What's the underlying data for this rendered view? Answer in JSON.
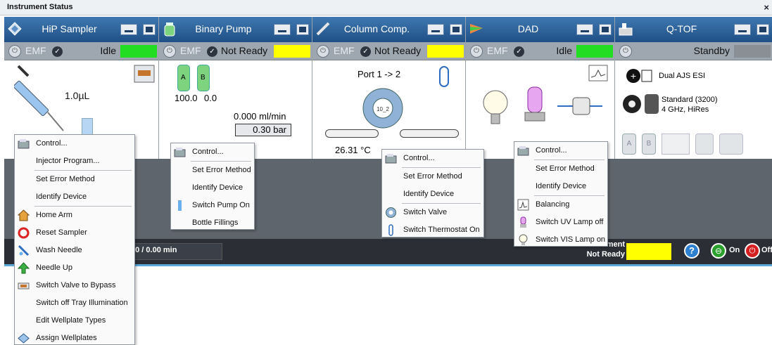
{
  "window": {
    "title": "Instrument Status",
    "close": "×"
  },
  "modules": [
    {
      "name": "HiP Sampler",
      "status": "Idle",
      "status_color": "#22dd22"
    },
    {
      "name": "Binary Pump",
      "status": "Not Ready",
      "status_color": "#ffff00"
    },
    {
      "name": "Column Comp.",
      "status": "Not Ready",
      "status_color": "#ffff00"
    },
    {
      "name": "DAD",
      "status": "Idle",
      "status_color": "#22dd22"
    },
    {
      "name": "Q-TOF",
      "status": "Standby",
      "status_color": "#8a8f96"
    }
  ],
  "emf_label": "EMF",
  "sampler": {
    "volume": "1.0µL"
  },
  "pump": {
    "bottle_a": "A",
    "bottle_b": "B",
    "val_a": "100.0",
    "val_b": "0.0",
    "flow": "0.000 ml/min",
    "pressure": "0.30 bar"
  },
  "column": {
    "port": "Port 1 -> 2",
    "temp_left": "26.31 °C",
    "valve_label": "10_2"
  },
  "qtof": {
    "source": "Dual AJS ESI",
    "mode_line1": "Standard (3200)",
    "mode_line2": "4 GHz, HiRes",
    "vial_a": "A",
    "vial_b": "B"
  },
  "bottom": {
    "runtime": "00 / 0.00 min",
    "instrument_label": "Instrument",
    "instrument_status": "Not Ready",
    "status_color": "#ffff00",
    "help": "?",
    "on_label": "On",
    "off_label": "Off"
  },
  "menus": {
    "sampler": [
      "Control...",
      "Injector Program...",
      "Set Error Method",
      "Identify Device",
      "Home Arm",
      "Reset Sampler",
      "Wash Needle",
      "Needle Up",
      "Switch Valve to Bypass",
      "Switch off Tray Illumination",
      "Edit Wellplate Types",
      "Assign Wellplates"
    ],
    "pump": [
      "Control...",
      "Set Error Method",
      "Identify Device",
      "Switch Pump On",
      "Bottle Fillings"
    ],
    "column": [
      "Control...",
      "Set Error Method",
      "Identify Device",
      "Switch Valve",
      "Switch Thermostat On"
    ],
    "dad": [
      "Control...",
      "Set Error Method",
      "Identify Device",
      "Balancing",
      "Switch UV Lamp off",
      "Switch VIS Lamp on"
    ]
  }
}
